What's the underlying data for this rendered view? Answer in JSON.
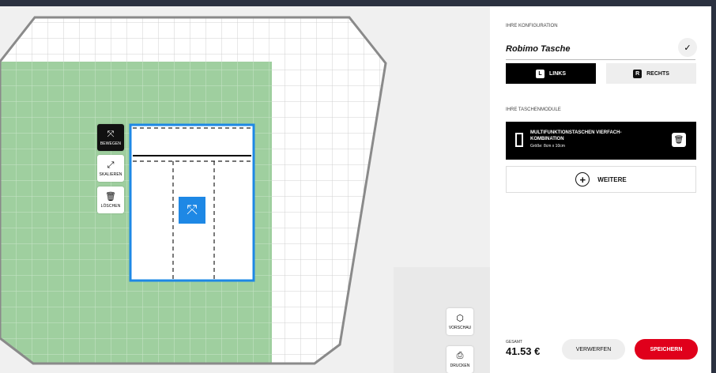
{
  "canvas": {
    "tools": [
      {
        "label": "BEWEGEN",
        "icon": "move-icon"
      },
      {
        "label": "SKALIEREN",
        "icon": "resize-icon"
      },
      {
        "label": "LÖSCHEN",
        "icon": "trash-icon"
      }
    ],
    "side_buttons": [
      {
        "label": "VORSCHAU",
        "icon": "cube-icon"
      },
      {
        "label": "DRUCKEN",
        "icon": "printer-icon"
      }
    ],
    "colors": {
      "grid_green": "#9fcf9f",
      "selection_blue": "#1e88e5",
      "outline_gray": "#8a8a8a"
    }
  },
  "panel": {
    "config_title": "IHRE KONFIGURATION",
    "config_name": "Robimo Tasche",
    "toggle": {
      "left": {
        "key": "L",
        "label": "LINKS"
      },
      "right": {
        "key": "R",
        "label": "RECHTS"
      }
    },
    "modules_title": "IHRE TASCHENMODULE",
    "module": {
      "title": "MULTIFUNKTIONSTASCHEN VIERFACH-KOMBINATION",
      "size": "Größe: 8cm x 10cm"
    },
    "more_label": "WEITERE",
    "total_label": "GESAMT",
    "total_value": "41.53 €",
    "discard_label": "VERWERFEN",
    "save_label": "SPEICHERN",
    "colors": {
      "accent": "#e0001b",
      "active_toggle": "#000000"
    }
  }
}
